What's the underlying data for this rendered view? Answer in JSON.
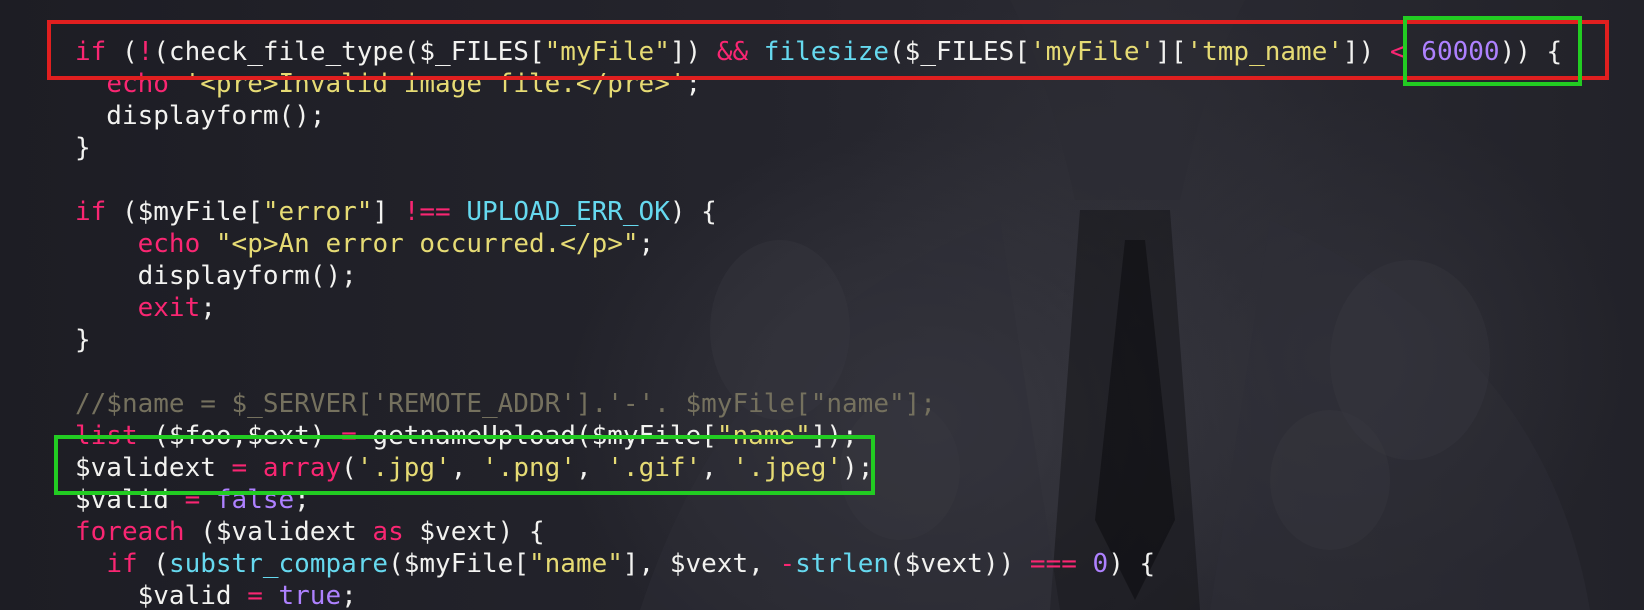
{
  "lines": [
    {
      "segments": [
        {
          "t": "if",
          "c": "kw"
        },
        {
          "t": " (",
          "c": "plain"
        },
        {
          "t": "!",
          "c": "op"
        },
        {
          "t": "(check_file_type($_FILES[",
          "c": "plain"
        },
        {
          "t": "\"myFile\"",
          "c": "str"
        },
        {
          "t": "]) ",
          "c": "plain"
        },
        {
          "t": "&&",
          "c": "op"
        },
        {
          "t": " ",
          "c": "plain"
        },
        {
          "t": "filesize",
          "c": "fn"
        },
        {
          "t": "($_FILES[",
          "c": "plain"
        },
        {
          "t": "'myFile'",
          "c": "str"
        },
        {
          "t": "][",
          "c": "plain"
        },
        {
          "t": "'tmp_name'",
          "c": "str"
        },
        {
          "t": "]) ",
          "c": "plain"
        },
        {
          "t": "<",
          "c": "op"
        },
        {
          "t": " ",
          "c": "plain"
        },
        {
          "t": "60000",
          "c": "num"
        },
        {
          "t": ")) {",
          "c": "plain"
        }
      ]
    },
    {
      "segments": [
        {
          "t": "  ",
          "c": "plain"
        },
        {
          "t": "echo",
          "c": "kw"
        },
        {
          "t": " ",
          "c": "plain"
        },
        {
          "t": "'<pre>Invalid image file.</pre>'",
          "c": "str"
        },
        {
          "t": ";",
          "c": "plain"
        }
      ]
    },
    {
      "segments": [
        {
          "t": "  displayform();",
          "c": "plain"
        }
      ]
    },
    {
      "segments": [
        {
          "t": "}",
          "c": "plain"
        }
      ]
    },
    {
      "segments": [
        {
          "t": "",
          "c": "plain"
        }
      ]
    },
    {
      "segments": [
        {
          "t": "if",
          "c": "kw"
        },
        {
          "t": " ($myFile[",
          "c": "plain"
        },
        {
          "t": "\"error\"",
          "c": "str"
        },
        {
          "t": "] ",
          "c": "plain"
        },
        {
          "t": "!==",
          "c": "op"
        },
        {
          "t": " ",
          "c": "plain"
        },
        {
          "t": "UPLOAD_ERR_OK",
          "c": "fn"
        },
        {
          "t": ") {",
          "c": "plain"
        }
      ]
    },
    {
      "segments": [
        {
          "t": "    ",
          "c": "plain"
        },
        {
          "t": "echo",
          "c": "kw"
        },
        {
          "t": " ",
          "c": "plain"
        },
        {
          "t": "\"<p>An error occurred.</p>\"",
          "c": "str"
        },
        {
          "t": ";",
          "c": "plain"
        }
      ]
    },
    {
      "segments": [
        {
          "t": "    displayform();",
          "c": "plain"
        }
      ]
    },
    {
      "segments": [
        {
          "t": "    ",
          "c": "plain"
        },
        {
          "t": "exit",
          "c": "kw"
        },
        {
          "t": ";",
          "c": "plain"
        }
      ]
    },
    {
      "segments": [
        {
          "t": "}",
          "c": "plain"
        }
      ]
    },
    {
      "segments": [
        {
          "t": "",
          "c": "plain"
        }
      ]
    },
    {
      "segments": [
        {
          "t": "//$name = $_SERVER['REMOTE_ADDR'].'-'. $myFile[\"name\"];",
          "c": "cmt"
        }
      ]
    },
    {
      "segments": [
        {
          "t": "list",
          "c": "kw"
        },
        {
          "t": " ($foo,$ext) ",
          "c": "plain"
        },
        {
          "t": "=",
          "c": "op"
        },
        {
          "t": " getnameUpload($myFile[",
          "c": "plain"
        },
        {
          "t": "\"name\"",
          "c": "str"
        },
        {
          "t": "]);",
          "c": "plain"
        }
      ]
    },
    {
      "segments": [
        {
          "t": "$validext ",
          "c": "plain"
        },
        {
          "t": "=",
          "c": "op"
        },
        {
          "t": " ",
          "c": "plain"
        },
        {
          "t": "array",
          "c": "kw"
        },
        {
          "t": "(",
          "c": "plain"
        },
        {
          "t": "'.jpg'",
          "c": "str"
        },
        {
          "t": ", ",
          "c": "plain"
        },
        {
          "t": "'.png'",
          "c": "str"
        },
        {
          "t": ", ",
          "c": "plain"
        },
        {
          "t": "'.gif'",
          "c": "str"
        },
        {
          "t": ", ",
          "c": "plain"
        },
        {
          "t": "'.jpeg'",
          "c": "str"
        },
        {
          "t": ");",
          "c": "plain"
        }
      ]
    },
    {
      "segments": [
        {
          "t": "$valid ",
          "c": "plain"
        },
        {
          "t": "=",
          "c": "op"
        },
        {
          "t": " ",
          "c": "plain"
        },
        {
          "t": "false",
          "c": "num"
        },
        {
          "t": ";",
          "c": "plain"
        }
      ]
    },
    {
      "segments": [
        {
          "t": "foreach",
          "c": "kw"
        },
        {
          "t": " ($validext ",
          "c": "plain"
        },
        {
          "t": "as",
          "c": "kw"
        },
        {
          "t": " $vext) {",
          "c": "plain"
        }
      ]
    },
    {
      "segments": [
        {
          "t": "  ",
          "c": "plain"
        },
        {
          "t": "if",
          "c": "kw"
        },
        {
          "t": " (",
          "c": "plain"
        },
        {
          "t": "substr_compare",
          "c": "fn"
        },
        {
          "t": "($myFile[",
          "c": "plain"
        },
        {
          "t": "\"name\"",
          "c": "str"
        },
        {
          "t": "], $vext, ",
          "c": "plain"
        },
        {
          "t": "-",
          "c": "op"
        },
        {
          "t": "strlen",
          "c": "fn"
        },
        {
          "t": "($vext)) ",
          "c": "plain"
        },
        {
          "t": "===",
          "c": "op"
        },
        {
          "t": " ",
          "c": "plain"
        },
        {
          "t": "0",
          "c": "num"
        },
        {
          "t": ") {",
          "c": "plain"
        }
      ]
    },
    {
      "segments": [
        {
          "t": "    $valid ",
          "c": "plain"
        },
        {
          "t": "=",
          "c": "op"
        },
        {
          "t": " ",
          "c": "plain"
        },
        {
          "t": "true",
          "c": "num"
        },
        {
          "t": ";",
          "c": "plain"
        }
      ]
    }
  ],
  "colors": {
    "keyword": "#f92672",
    "function": "#66d9ef",
    "string": "#e6db74",
    "number": "#ae81ff",
    "comment": "#75715e",
    "text": "#f2f2f0",
    "highlight_red": "#e01f1f",
    "highlight_green": "#22cc22"
  }
}
